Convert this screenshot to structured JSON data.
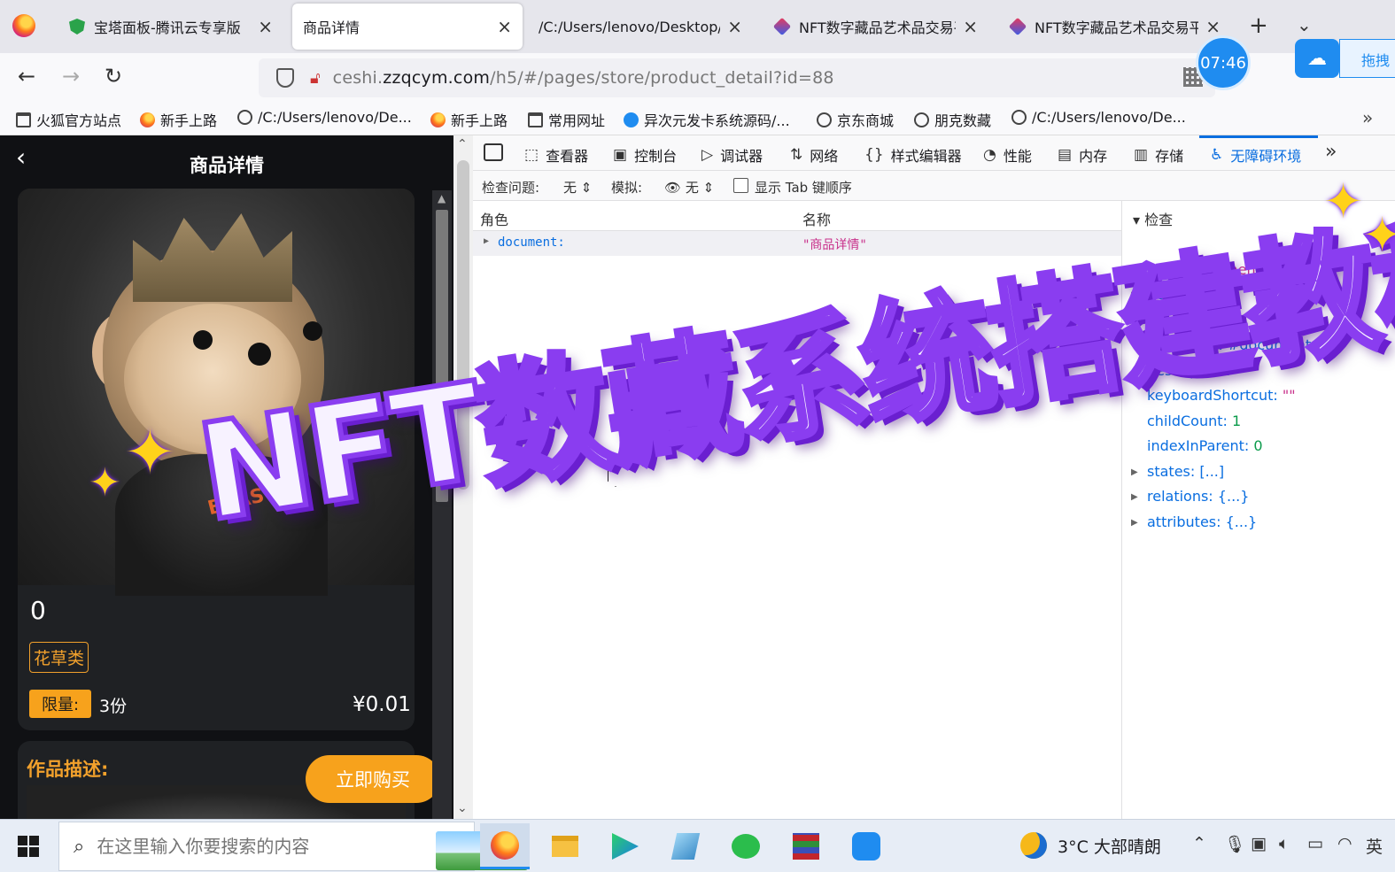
{
  "browser": {
    "tabs": [
      {
        "title": "宝塔面板-腾讯云专享版",
        "favicon": "shield-favicon"
      },
      {
        "title": "商品详情",
        "favicon": "none",
        "active": true
      },
      {
        "title": "/C:/Users/lenovo/Desktop/c",
        "favicon": "none"
      },
      {
        "title": "NFT数字藏品艺术品交易平",
        "favicon": "nft-favicon"
      },
      {
        "title": "NFT数字藏品艺术品交易平",
        "favicon": "nft-favicon"
      }
    ],
    "url_prefix": "ceshi.",
    "url_domain": "zzqcym.com",
    "url_path": "/h5/#/pages/store/product_detail?id=88",
    "clock_badge": "07:46",
    "drag_label": "拖拽",
    "bookmarks": [
      {
        "label": "火狐官方站点",
        "icon": "folder-icon"
      },
      {
        "label": "新手上路",
        "icon": "firefox-icon"
      },
      {
        "label": "/C:/Users/lenovo/De...",
        "icon": "globe-icon"
      },
      {
        "label": "新手上路",
        "icon": "firefox-icon"
      },
      {
        "label": "常用网址",
        "icon": "folder-icon"
      },
      {
        "label": "异次元发卡系统源码/...",
        "icon": "cloud-icon"
      },
      {
        "label": "京东商城",
        "icon": "globe-icon"
      },
      {
        "label": "朋克数藏",
        "icon": "globe-icon"
      },
      {
        "label": "/C:/Users/lenovo/De...",
        "icon": "globe-icon"
      }
    ]
  },
  "phone": {
    "title": "商品详情",
    "price_zero": "0",
    "category": "花草类",
    "limit_label": "限量:",
    "limit_count": "3份",
    "price": "¥0.01",
    "desc_title": "作品描述:",
    "buy_label": "立即购买",
    "jacket_text": "BEAST"
  },
  "devtools": {
    "tabs": [
      {
        "label": "查看器",
        "icon": "inspector-icon"
      },
      {
        "label": "控制台",
        "icon": "console-icon"
      },
      {
        "label": "调试器",
        "icon": "debugger-icon"
      },
      {
        "label": "网络",
        "icon": "network-icon"
      },
      {
        "label": "样式编辑器",
        "icon": "style-editor-icon"
      },
      {
        "label": "性能",
        "icon": "performance-icon"
      },
      {
        "label": "内存",
        "icon": "memory-icon"
      },
      {
        "label": "存储",
        "icon": "storage-icon"
      },
      {
        "label": "无障碍环境",
        "icon": "accessibility-icon",
        "active": true
      }
    ],
    "filter": {
      "check_label": "检查问题:",
      "check_value": "无",
      "simulate_label": "模拟:",
      "simulate_value": "无",
      "tab_order_label": "显示 Tab 键顺序"
    },
    "tree": {
      "col_role": "角色",
      "col_name": "名称",
      "row_role": "document:",
      "row_name": "\"商品详情\""
    },
    "inspect": {
      "header": "检查",
      "props": [
        {
          "key": "role:",
          "value": "\"document\"",
          "kind": "str",
          "expandable": false
        },
        {
          "key": "actions:",
          "value": "[]",
          "kind": "plain",
          "expandable": true
        },
        {
          "key": "value:",
          "value": "\"\"",
          "kind": "str",
          "expandable": false
        },
        {
          "key": "DOMNode:",
          "value": "#document",
          "kind": "plain",
          "expandable": false
        },
        {
          "key": "description:",
          "value": "\"\"",
          "kind": "str",
          "expandable": false
        },
        {
          "key": "keyboardShortcut:",
          "value": "\"\"",
          "kind": "str",
          "expandable": false
        },
        {
          "key": "childCount:",
          "value": "1",
          "kind": "num",
          "expandable": false
        },
        {
          "key": "indexInParent:",
          "value": "0",
          "kind": "num",
          "expandable": false
        },
        {
          "key": "states:",
          "value": "[...]",
          "kind": "plain",
          "expandable": true
        },
        {
          "key": "relations:",
          "value": "{...}",
          "kind": "plain",
          "expandable": true
        },
        {
          "key": "attributes:",
          "value": "{...}",
          "kind": "plain",
          "expandable": true
        }
      ]
    }
  },
  "overlay": {
    "banner_text": "NFT数藏系统搭建教程",
    "banner_color": "#8a3df0",
    "sparkle_color": "#ffd21a"
  },
  "taskbar": {
    "search_placeholder": "在这里输入你要搜索的内容",
    "apps": [
      "firefox-icon",
      "file-explorer-icon",
      "media-player-icon",
      "notepad-icon",
      "wechat-icon",
      "winrar-icon",
      "baidu-netdisk-icon"
    ],
    "weather": "3°C 大部晴朗",
    "ime": "英"
  }
}
